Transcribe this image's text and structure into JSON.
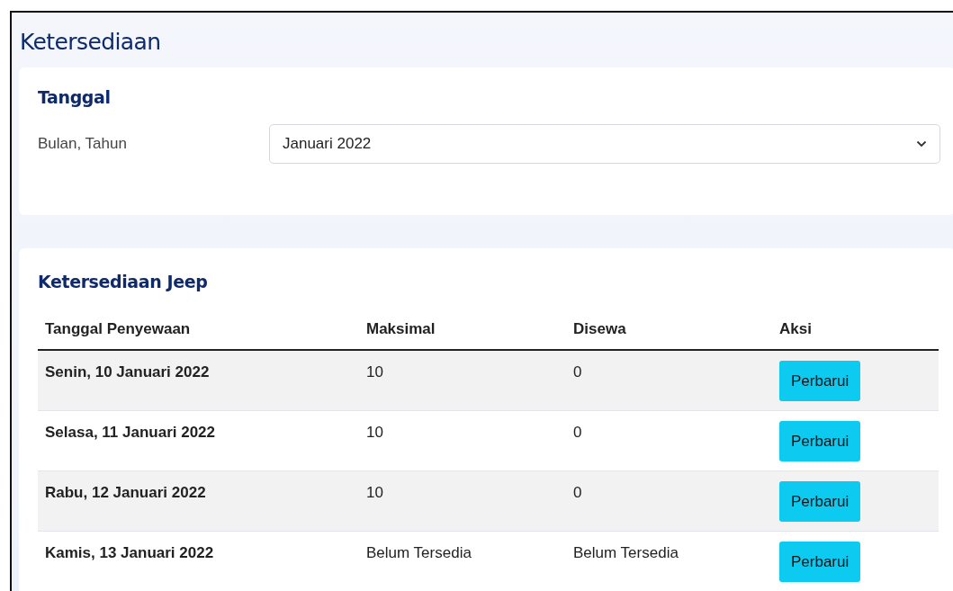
{
  "page_title": "Ketersediaan",
  "date_card": {
    "title": "Tanggal",
    "field_label": "Bulan, Tahun",
    "month_select": {
      "value": "Januari 2022"
    }
  },
  "availability_card": {
    "title": "Ketersediaan Jeep",
    "table": {
      "columns": [
        "Tanggal Penyewaan",
        "Maksimal",
        "Disewa",
        "Aksi"
      ],
      "rows": [
        {
          "date": "Senin, 10 Januari 2022",
          "max": "10",
          "rented": "0",
          "action": "Perbarui"
        },
        {
          "date": "Selasa, 11 Januari 2022",
          "max": "10",
          "rented": "0",
          "action": "Perbarui"
        },
        {
          "date": "Rabu, 12 Januari 2022",
          "max": "10",
          "rented": "0",
          "action": "Perbarui"
        },
        {
          "date": "Kamis, 13 Januari 2022",
          "max": "Belum Tersedia",
          "rented": "Belum Tersedia",
          "action": "Perbarui"
        }
      ]
    }
  }
}
